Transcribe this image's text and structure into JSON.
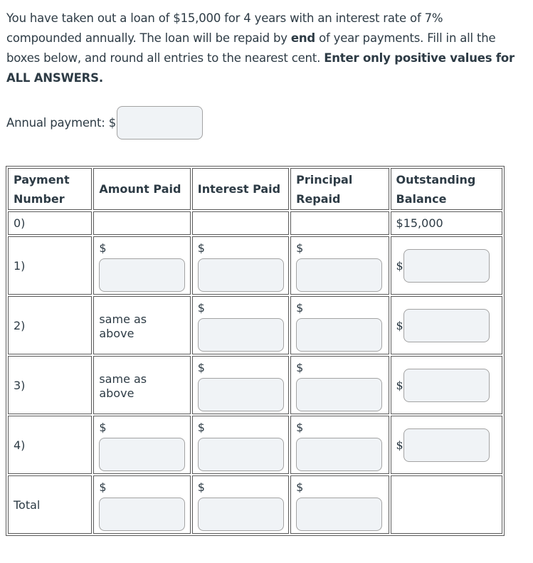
{
  "prompt": {
    "part1": "You have taken out a loan of $15,000 for 4 years with an interest rate of 7% compounded annually. The loan will be repaid by ",
    "bold1": "end",
    "part2": " of year payments. Fill in all the boxes below, and round all entries to the nearest cent. ",
    "bold2": "Enter only positive values for ALL ANSWERS."
  },
  "annual_payment": {
    "label": "Annual payment: $",
    "value": "",
    "placeholder": ""
  },
  "table": {
    "headers": [
      "Payment Number",
      "Amount Paid",
      "Interest Paid",
      "Principal Repaid",
      "Outstanding Balance"
    ],
    "currency_symbol": "$",
    "same_as_above": "same as above",
    "rows": [
      {
        "label": "0)",
        "outstanding_balance": "$15,000"
      },
      {
        "label": "1)",
        "amount_paid": "",
        "interest_paid": "",
        "principal_repaid": "",
        "outstanding_balance": ""
      },
      {
        "label": "2)",
        "amount_paid_text": "same as above",
        "interest_paid": "",
        "principal_repaid": "",
        "outstanding_balance": ""
      },
      {
        "label": "3)",
        "amount_paid_text": "same as above",
        "interest_paid": "",
        "principal_repaid": "",
        "outstanding_balance": ""
      },
      {
        "label": "4)",
        "amount_paid": "",
        "interest_paid": "",
        "principal_repaid": "",
        "outstanding_balance": ""
      },
      {
        "label": "Total",
        "amount_paid": "",
        "interest_paid": "",
        "principal_repaid": ""
      }
    ]
  }
}
